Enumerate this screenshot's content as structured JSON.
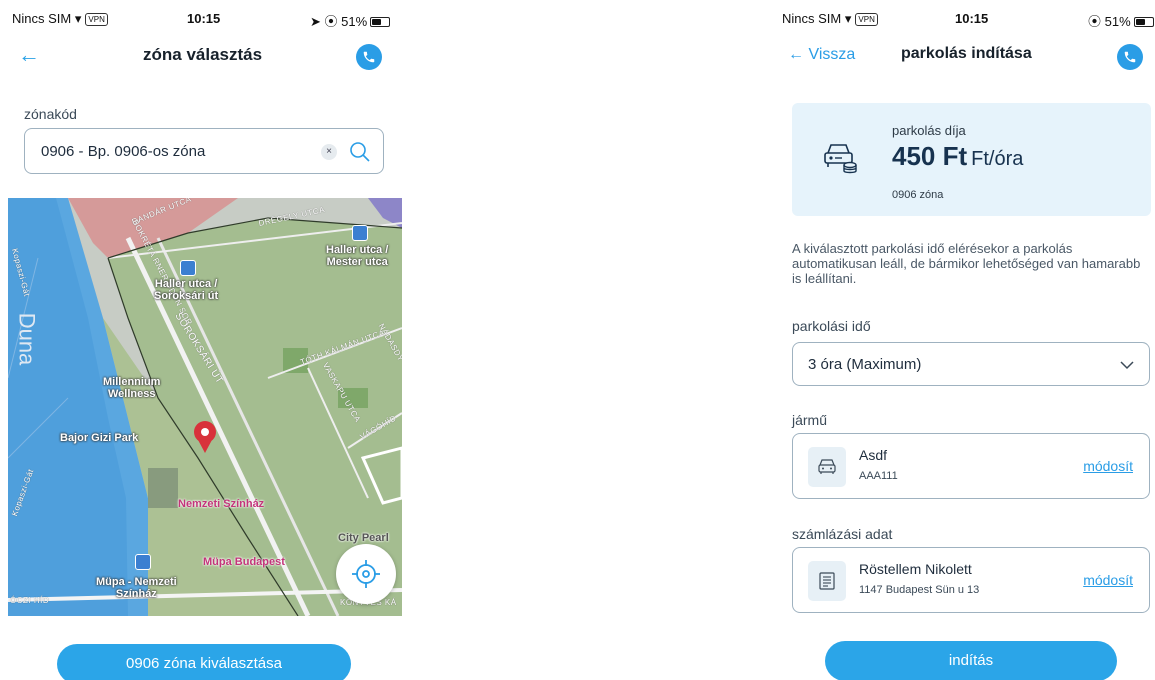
{
  "status_bar_left": {
    "carrier": "Nincs SIM",
    "vpn": "VPN",
    "time": "10:15",
    "battery": "51%"
  },
  "status_bar_right": {
    "carrier": "Nincs SIM",
    "vpn": "VPN",
    "time": "10:15",
    "battery": "51%"
  },
  "zone_screen": {
    "title": "zóna választás",
    "zone_code_label": "zónakód",
    "zone_input_value": "0906 - Bp. 0906-os zóna",
    "clear_symbol": "×",
    "map": {
      "river": "Duna",
      "labels": {
        "haller_mester": "Haller utca /\nMester utca",
        "haller_soroksari": "Haller utca /\nSoroksári út",
        "millennium": "Millennium\nWellness",
        "bajor_gizi": "Bajor Gizi Park",
        "nemzeti_szinhaz": "Nemzeti Színház",
        "mupa": "Müpa Budapest",
        "mupa_nemzeti": "Müpa - Nemzeti\nSzínház",
        "city_pearl": "City Pearl"
      },
      "streets": {
        "soroksari": "SOROKSÁRI ÚT",
        "toth_kalman": "TÓTH KÁLMÁN UTCA",
        "vaskapu": "VASKAPU UTCA",
        "dandar": "DANDÁR UTCA",
        "dregely": "DRÉGELY UTCA",
        "bokrekner": "BOKRÉTA RNER ÖDÖN SOR",
        "nadasdy": "NÁDASDY",
        "vagohid": "VÁGÓHÍD",
        "konyves": "KÖNYVES KÁ",
        "kopaszi_1": "Kopaszi-Gát",
        "kopaszi_2": "Kopaszi-Gát",
        "rakoczi": "ÓCZI HÍD"
      }
    },
    "select_button": "0906 zóna kiválasztása"
  },
  "parking_screen": {
    "back_label": "Vissza",
    "title": "parkolás indítása",
    "fee_label": "parkolás díja",
    "fee_amount": "450 Ft",
    "fee_unit": "Ft/óra",
    "fee_zone": "0906 zóna",
    "info_text": "A kiválasztott parkolási idő elérésekor a parkolás automatikusan leáll, de bármikor lehetőséged van hamarabb is leállítani.",
    "duration_label": "parkolási idő",
    "duration_value": "3 óra (Maximum)",
    "vehicle_label": "jármű",
    "vehicle_name": "Asdf",
    "vehicle_plate": "AAA111",
    "billing_label": "számlázási adat",
    "billing_name": "Röstellem Nikolett",
    "billing_address": "1147 Budapest Sün u 13",
    "edit_link": "módosít",
    "start_button": "indítás"
  },
  "colors": {
    "accent": "#2ba5e8",
    "card_bg": "#e6f3fb",
    "map_green": "#a9c08e",
    "river": "#5aa7e0"
  }
}
